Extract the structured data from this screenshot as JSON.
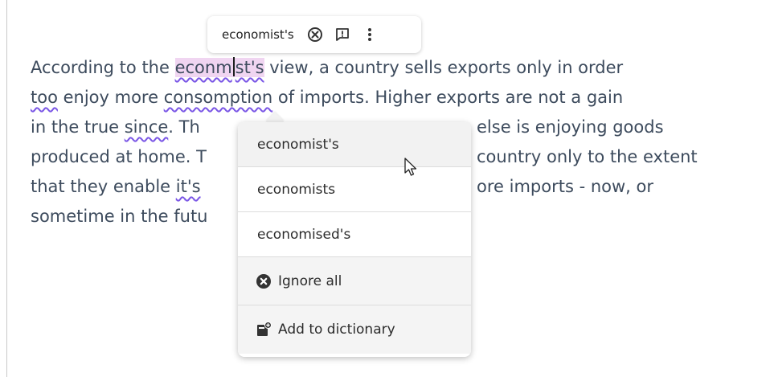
{
  "editor": {
    "lines": [
      [
        "According to the ",
        "econm",
        "st's",
        " view, a country sells exports only in order"
      ],
      [
        "too",
        " enjoy more ",
        "consomption",
        " of imports. Higher exports are not a gain"
      ],
      [
        "in the true ",
        "since",
        ". Th",
        "else is enjoying goods"
      ],
      [
        "produced at home. T",
        "country only to the extent"
      ],
      [
        "that they enable ",
        "it's",
        "ore imports - now, or"
      ],
      [
        "sometime in the futu"
      ]
    ]
  },
  "toolbar": {
    "word": "economist's",
    "icons": [
      "dismiss-circle-icon",
      "report-icon",
      "more-vertical-icon"
    ]
  },
  "dropdown": {
    "suggestions": [
      "economist's",
      "economists",
      "economised's"
    ],
    "ignore_all": "Ignore all",
    "add_to_dictionary": "Add to dictionary"
  },
  "colors": {
    "text": "#3d4b5d",
    "highlight": "#f0d5f1",
    "squiggle": "#7a56e6"
  }
}
